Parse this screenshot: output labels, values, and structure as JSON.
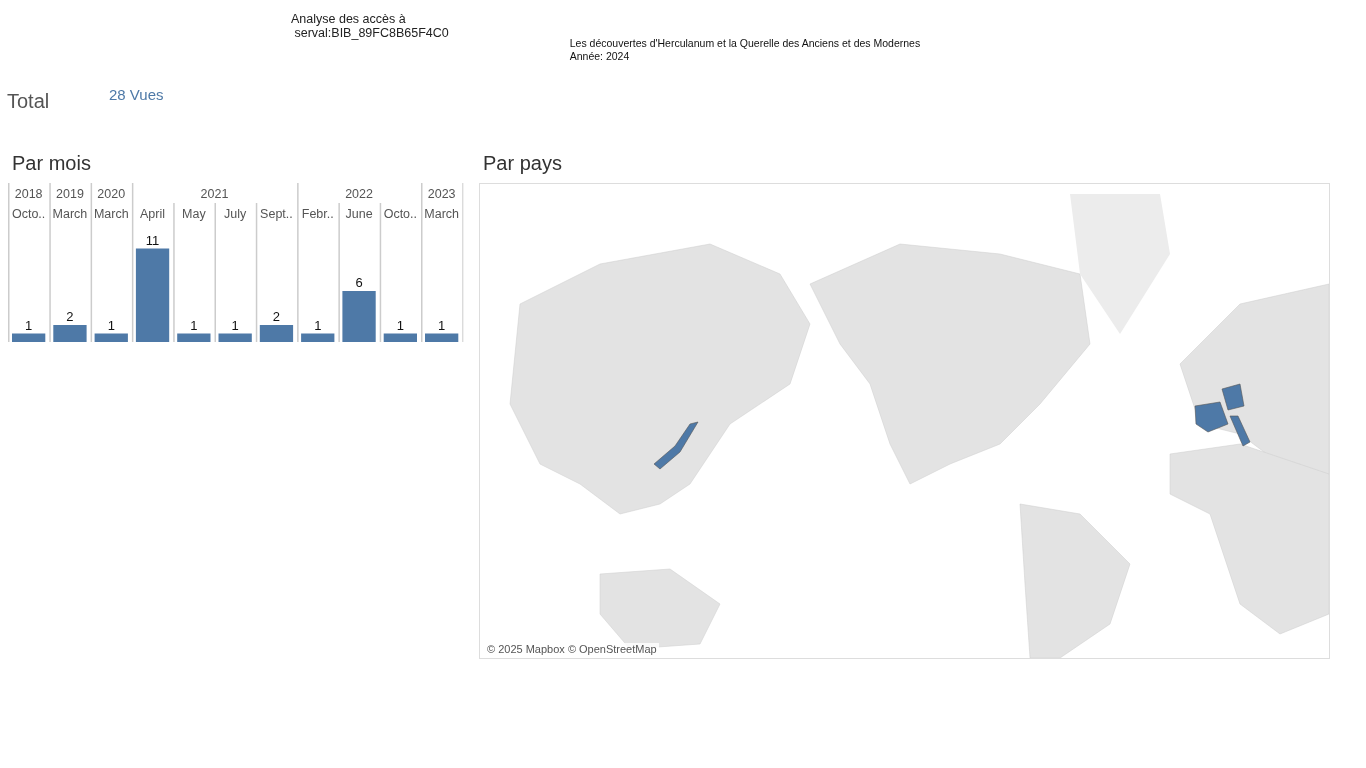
{
  "header": {
    "title_lines": [
      "Analyse des accès à",
      " serval:BIB_89FC8B65F4C0"
    ],
    "document_title": "Les découvertes d'Herculanum et la Querelle des Anciens et des Modernes",
    "year_line": "Année: 2024"
  },
  "total": {
    "label": "Total",
    "value": "28 Vues"
  },
  "monthly": {
    "title": "Par mois",
    "year_groups": [
      "2018",
      "2019",
      "2020",
      "2021",
      "2022",
      "2023"
    ],
    "month_starts_year": [
      true,
      true,
      true,
      true,
      false,
      false,
      false,
      true,
      false,
      false,
      true
    ],
    "chart_data": {
      "type": "bar",
      "data_labels": true,
      "categories": [
        "Octo..",
        "March",
        "March",
        "April",
        "May",
        "July",
        "Sept..",
        "Febr..",
        "June",
        "Octo..",
        "March"
      ],
      "values": [
        1,
        2,
        1,
        11,
        1,
        1,
        2,
        1,
        6,
        1,
        1
      ]
    }
  },
  "countries": {
    "title": "Par pays",
    "attribution": "© 2025 Mapbox © OpenStreetMap"
  }
}
